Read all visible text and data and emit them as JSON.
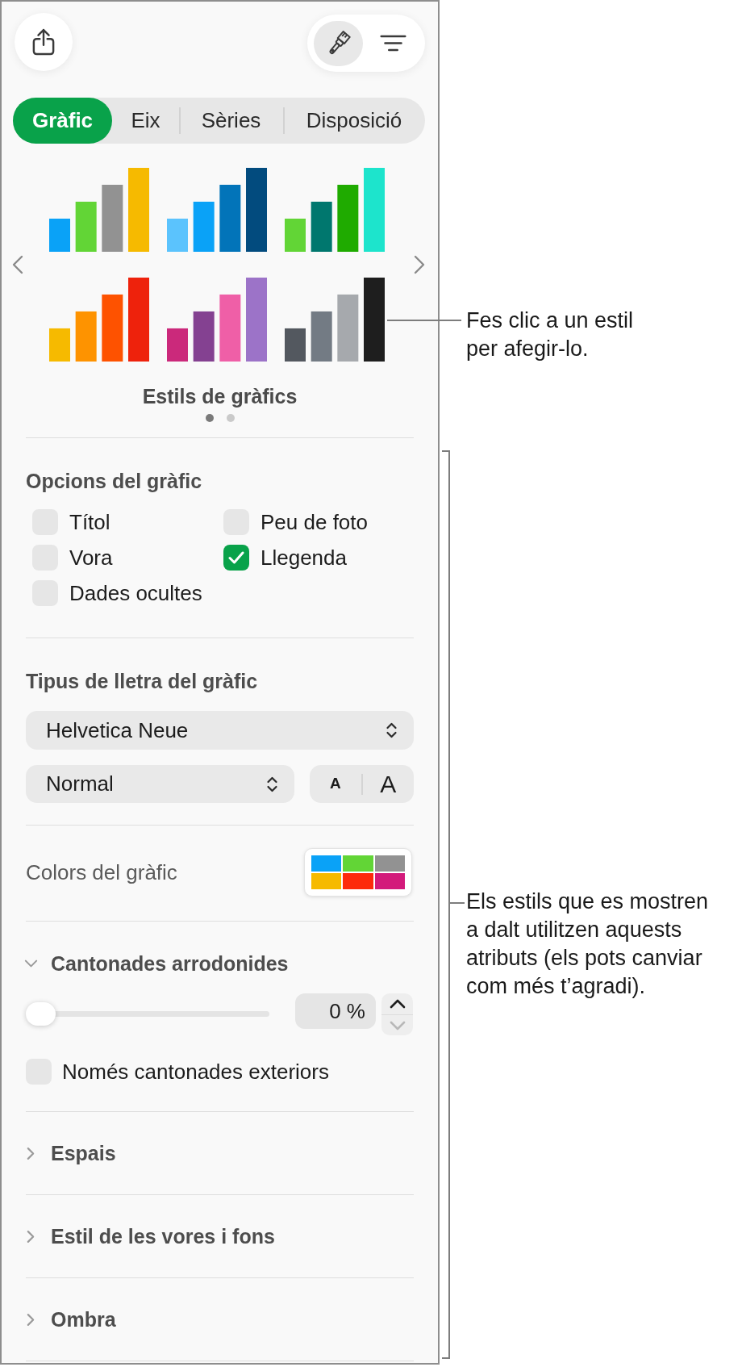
{
  "toolbar": {
    "view_buttons": [
      {
        "kind": "brush",
        "selected": true
      },
      {
        "kind": "list",
        "selected": false
      }
    ]
  },
  "tabs": [
    {
      "label": "Gràfic",
      "selected": true
    },
    {
      "label": "Eix",
      "selected": false
    },
    {
      "label": "Sèries",
      "selected": false
    },
    {
      "label": "Disposició",
      "selected": false
    }
  ],
  "chart_styles": {
    "styles": [
      {
        "bars": [
          {
            "color": "#0aa2f7"
          },
          {
            "color": "#62d536"
          },
          {
            "color": "#929292"
          },
          {
            "color": "#f6ba00"
          }
        ]
      },
      {
        "bars": [
          {
            "color": "#5bc3fd"
          },
          {
            "color": "#0aa2f7"
          },
          {
            "color": "#0274b9"
          },
          {
            "color": "#024b7e"
          }
        ]
      },
      {
        "bars": [
          {
            "color": "#62d536"
          },
          {
            "color": "#00776e"
          },
          {
            "color": "#1fab00"
          },
          {
            "color": "#1de4cc"
          }
        ]
      },
      {
        "bars": [
          {
            "color": "#f6ba00"
          },
          {
            "color": "#fe9300"
          },
          {
            "color": "#fe5200"
          },
          {
            "color": "#ee220c"
          }
        ]
      },
      {
        "bars": [
          {
            "color": "#cb297b"
          },
          {
            "color": "#844191"
          },
          {
            "color": "#ef5fa7"
          },
          {
            "color": "#9c73c8"
          }
        ]
      },
      {
        "bars": [
          {
            "color": "#53585f"
          },
          {
            "color": "#737b84"
          },
          {
            "color": "#a6a9ad"
          },
          {
            "color": "#1e1e1e"
          }
        ]
      }
    ],
    "title": "Estils de gràfics",
    "pages": [
      {
        "selected": true
      },
      {
        "selected": false
      }
    ]
  },
  "chart_options": {
    "title": "Opcions del gràfic",
    "options": [
      {
        "label": "Títol",
        "checked": false
      },
      {
        "label": "Peu de foto",
        "checked": false
      },
      {
        "label": "Vora",
        "checked": false
      },
      {
        "label": "Llegenda",
        "checked": true
      },
      {
        "label": "Dades ocultes",
        "checked": false
      }
    ]
  },
  "chart_font": {
    "title": "Tipus de lletra del gràfic",
    "family": "Helvetica Neue",
    "style": "Normal",
    "size_buttons": [
      "A",
      "A"
    ]
  },
  "chart_colors": {
    "label": "Colors del gràfic",
    "swatches": [
      {
        "color": "#0aa2f7"
      },
      {
        "color": "#62d536"
      },
      {
        "color": "#929292"
      },
      {
        "color": "#f6ba00"
      },
      {
        "color": "#fd2a0b"
      },
      {
        "color": "#d31a7b"
      }
    ]
  },
  "sections": [
    {
      "title": "Cantonades arrodonides",
      "expanded": true,
      "slider": {
        "level": 0
      },
      "value": "0 %",
      "stepper": [
        {
          "kind": "up",
          "disabled": false
        },
        {
          "kind": "down",
          "disabled": true
        }
      ],
      "options": [
        {
          "label": "Només cantonades exteriors",
          "checked": false
        }
      ]
    },
    {
      "title": "Espais",
      "expanded": false
    },
    {
      "title": "Estil de les vores i fons",
      "expanded": false
    },
    {
      "title": "Ombra",
      "expanded": false
    }
  ],
  "callouts": [
    {
      "text": "Fes clic a un estil per afegir-lo."
    },
    {
      "text": "Els estils que es mostren a dalt utilitzen aquests atributs (els pots canviar com més t’agradi)."
    }
  ]
}
